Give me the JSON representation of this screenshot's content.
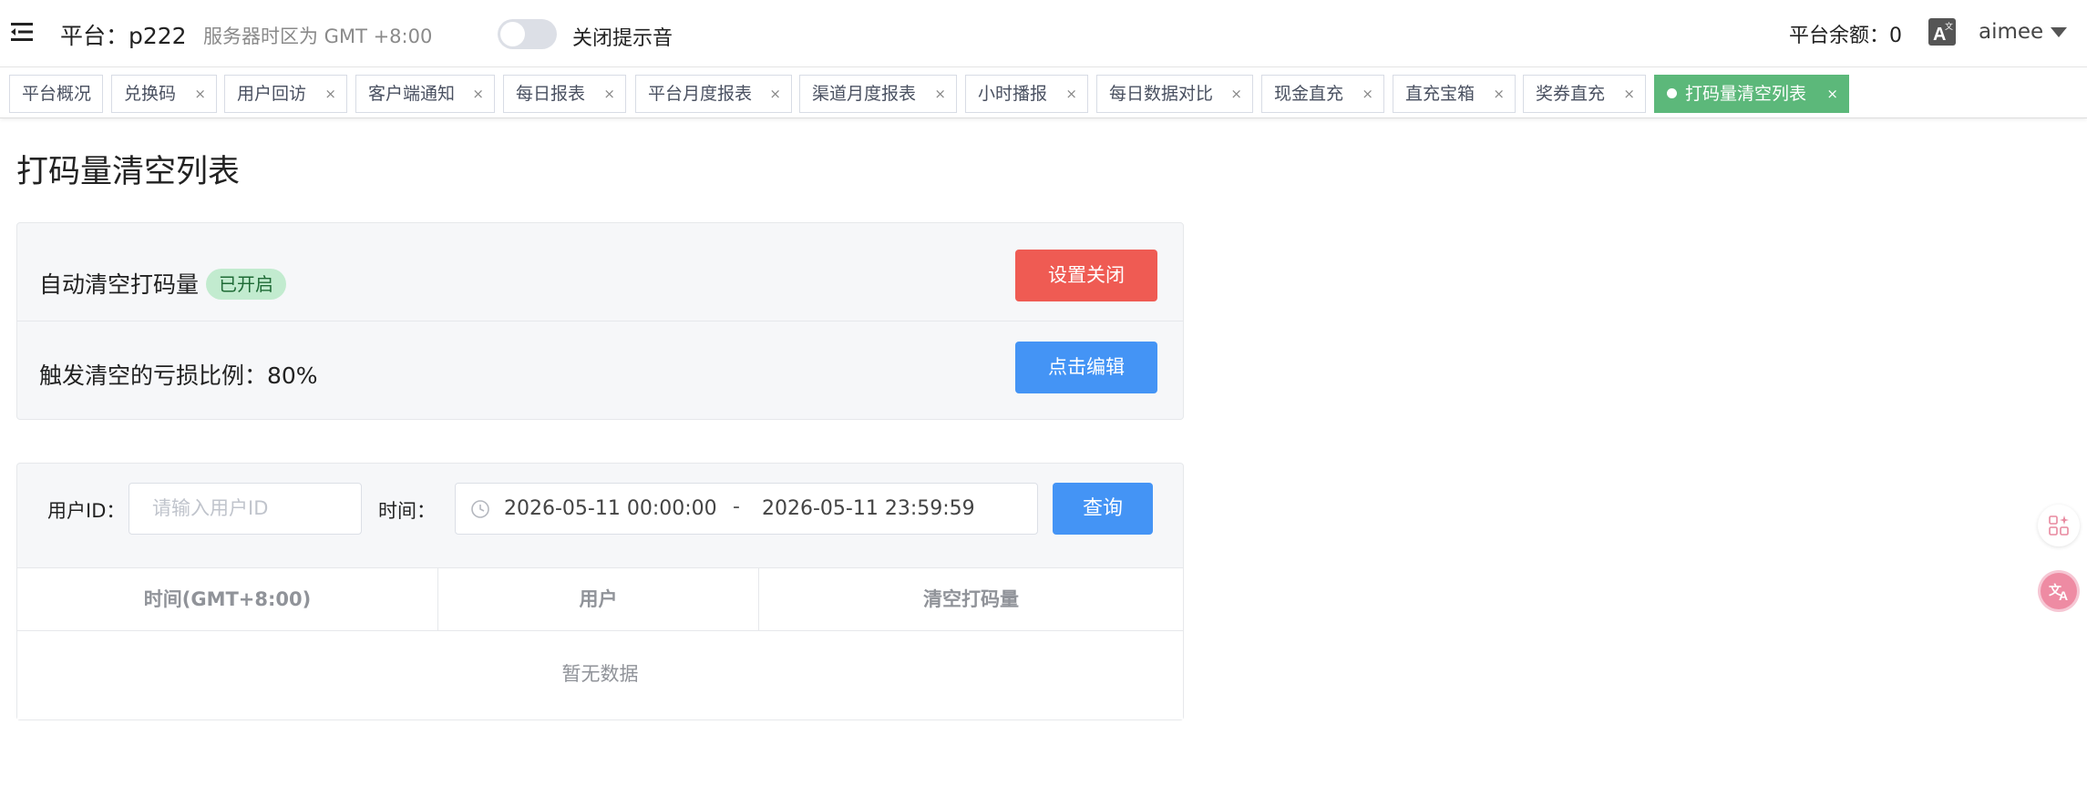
{
  "header": {
    "platform_text": "平台：p222",
    "timezone_text": "服务器时区为 GMT +8:00",
    "sound_switch_label": "关闭提示音",
    "balance_text": "平台余额：0",
    "username": "aimee"
  },
  "tags": [
    {
      "label": "平台概况",
      "closable": false,
      "active": false
    },
    {
      "label": "兑换码",
      "closable": true,
      "active": false
    },
    {
      "label": "用户回访",
      "closable": true,
      "active": false
    },
    {
      "label": "客户端通知",
      "closable": true,
      "active": false
    },
    {
      "label": "每日报表",
      "closable": true,
      "active": false
    },
    {
      "label": "平台月度报表",
      "closable": true,
      "active": false
    },
    {
      "label": "渠道月度报表",
      "closable": true,
      "active": false
    },
    {
      "label": "小时播报",
      "closable": true,
      "active": false
    },
    {
      "label": "每日数据对比",
      "closable": true,
      "active": false
    },
    {
      "label": "现金直充",
      "closable": true,
      "active": false
    },
    {
      "label": "直充宝箱",
      "closable": true,
      "active": false
    },
    {
      "label": "奖券直充",
      "closable": true,
      "active": false
    },
    {
      "label": "打码量清空列表",
      "closable": true,
      "active": true
    }
  ],
  "tag_close_glyph": "×",
  "page": {
    "title": "打码量清空列表"
  },
  "settings": {
    "auto_clear_label": "自动清空打码量",
    "auto_clear_status": "已开启",
    "auto_clear_button": "设置关闭",
    "loss_ratio_label": "触发清空的亏损比例：80%",
    "loss_ratio_button": "点击编辑"
  },
  "query": {
    "user_id_label": "用户ID：",
    "user_id_placeholder": "请输入用户ID",
    "time_label": "时间：",
    "start_time": "2026-05-11 00:00:00",
    "range_separator": "-",
    "end_time": "2026-05-11 23:59:59",
    "query_button": "查询"
  },
  "table": {
    "columns": [
      "时间(GMT+8:00)",
      "用户",
      "清空打码量"
    ],
    "empty_text": "暂无数据"
  },
  "colors": {
    "active_tag": "#5cb87a",
    "danger": "#ef5b53",
    "primary": "#4494f5",
    "status_badge_bg": "#c2ebcf"
  }
}
